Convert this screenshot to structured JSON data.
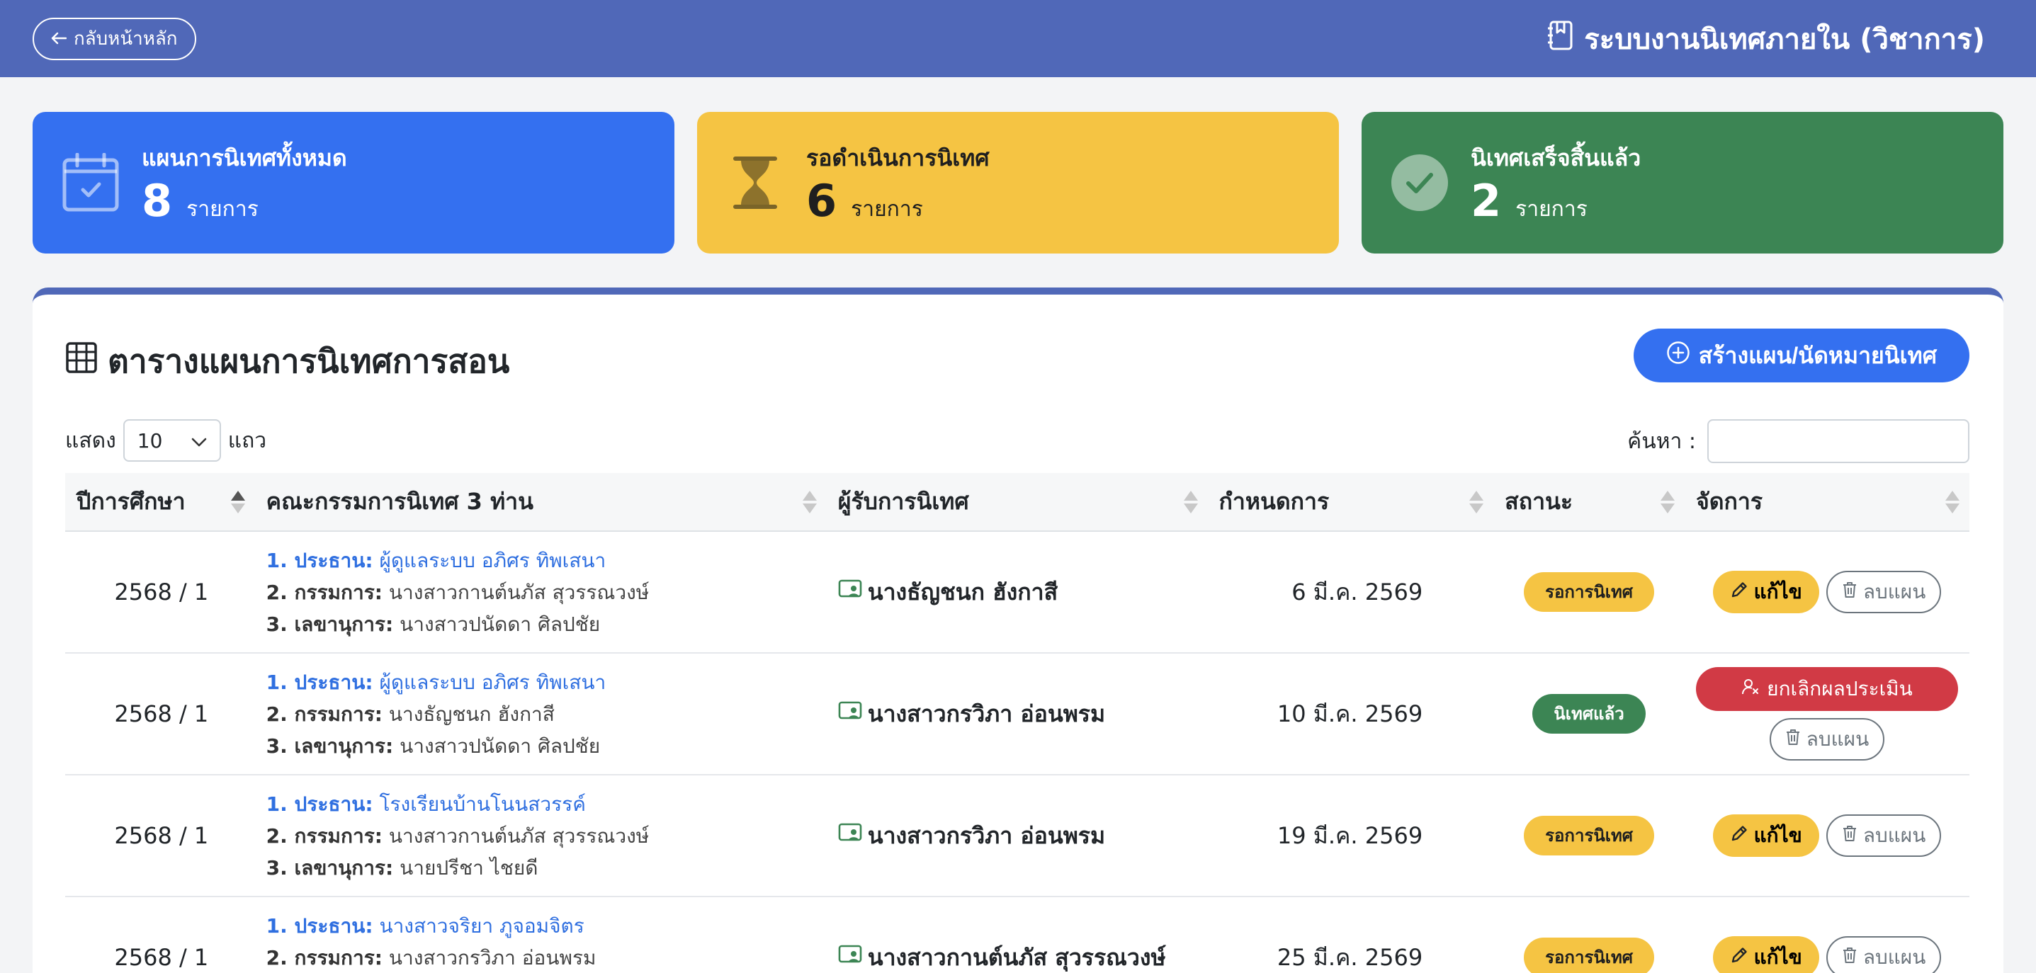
{
  "header": {
    "back_label": "กลับหน้าหลัก",
    "back_icon": "arrow-left-icon",
    "title": "ระบบงานนิเทศภายใน (วิชาการ)",
    "title_icon": "journal-bookmark-icon"
  },
  "stats": [
    {
      "label": "แผนการนิเทศทั้งหมด",
      "count": "8",
      "unit": "รายการ",
      "icon": "calendar-check-icon",
      "color": "#3470f0"
    },
    {
      "label": "รอดำเนินการนิเทศ",
      "count": "6",
      "unit": "รายการ",
      "icon": "hourglass-icon",
      "color": "#f5c443"
    },
    {
      "label": "นิเทศเสร็จสิ้นแล้ว",
      "count": "2",
      "unit": "รายการ",
      "icon": "check-circle-icon",
      "color": "#3c8554"
    }
  ],
  "panel": {
    "title": "ตารางแผนการนิเทศการสอน",
    "title_icon": "table-icon",
    "create_label": "สร้างแผน/นัดหมายนิเทศ",
    "create_icon": "plus-circle-icon",
    "show_label": "แสดง",
    "page_length": "10",
    "rows_label": "แถว",
    "search_label": "ค้นหา :",
    "search_value": ""
  },
  "table": {
    "columns": [
      "ปีการศึกษา",
      "คณะกรรมการนิเทศ 3 ท่าน",
      "ผู้รับการนิเทศ",
      "กำหนดการ",
      "สถานะ",
      "จัดการ"
    ],
    "chair_prefix": "1. ประธาน:",
    "member_prefix": "2. กรรมการ:",
    "secretary_prefix": "3. เลขานุการ:",
    "edit_label": "แก้ไข",
    "delete_label": "ลบแผน",
    "cancel_label": "ยกเลิกผลประเมิน",
    "rows": [
      {
        "year": "2568 / 1",
        "chair": "ผู้ดูแลระบบ อภิศร ทิพเสนา",
        "member": "นางสาวกานต์นภัส สุวรรณวงษ์",
        "secretary": "นางสาวปนัดดา ศิลปชัย",
        "supervisee": "นางธัญชนก ฮังกาสี",
        "date": "6 มี.ค. 2569",
        "status": "รอการนิเทศ",
        "status_type": "wait"
      },
      {
        "year": "2568 / 1",
        "chair": "ผู้ดูแลระบบ อภิศร ทิพเสนา",
        "member": "นางธัญชนก ฮังกาสี",
        "secretary": "นางสาวปนัดดา ศิลปชัย",
        "supervisee": "นางสาวกรวิภา อ่อนพรม",
        "date": "10 มี.ค. 2569",
        "status": "นิเทศแล้ว",
        "status_type": "done"
      },
      {
        "year": "2568 / 1",
        "chair": "โรงเรียนบ้านโนนสวรรค์",
        "member": "นางสาวกานต์นภัส สุวรรณวงษ์",
        "secretary": "นายปรีชา ไชยดี",
        "supervisee": "นางสาวกรวิภา อ่อนพรม",
        "date": "19 มี.ค. 2569",
        "status": "รอการนิเทศ",
        "status_type": "wait"
      },
      {
        "year": "2568 / 1",
        "chair": "นางสาวจริยา ภูจอมจิตร",
        "member": "นางสาวกรวิภา อ่อนพรม",
        "secretary": "",
        "supervisee": "นางสาวกานต์นภัส สุวรรณวงษ์",
        "date": "25 มี.ค. 2569",
        "status": "รอการนิเทศ",
        "status_type": "wait"
      }
    ]
  }
}
